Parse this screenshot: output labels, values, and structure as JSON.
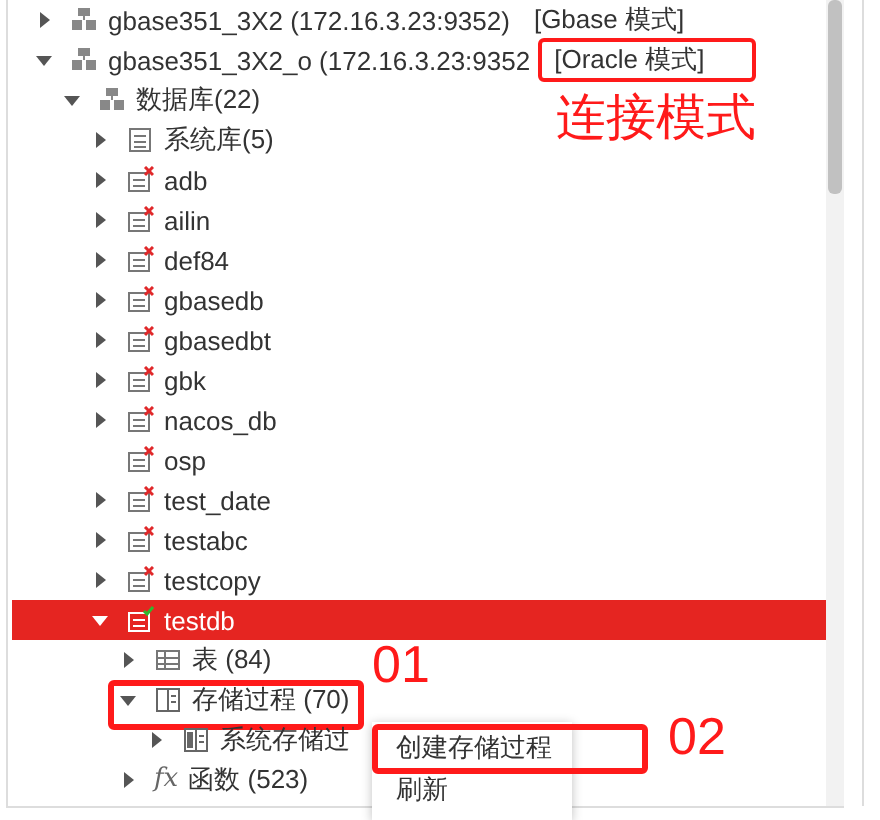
{
  "tree": [
    {
      "label": "gbase351_3X2 (172.16.3.23:9352)",
      "mode": "[Gbase 模式]",
      "mode_highlighted": false,
      "kind": "server",
      "expanded": false,
      "selected": false
    },
    {
      "label": "gbase351_3X2_o (172.16.3.23:9352",
      "mode": "[Oracle 模式]",
      "mode_highlighted": true,
      "kind": "server",
      "expanded": true,
      "selected": false,
      "children": [
        {
          "label": "数据库(22)",
          "kind": "server",
          "expanded": true,
          "selected": false,
          "children": [
            {
              "label": "系统库(5)",
              "kind": "sys_db",
              "expanded": false,
              "selected": false
            },
            {
              "label": "adb",
              "kind": "db_closed",
              "expanded": false,
              "selected": false
            },
            {
              "label": "ailin",
              "kind": "db_closed",
              "expanded": false,
              "selected": false
            },
            {
              "label": "def84",
              "kind": "db_closed",
              "expanded": false,
              "selected": false
            },
            {
              "label": "gbasedb",
              "kind": "db_closed",
              "expanded": false,
              "selected": false
            },
            {
              "label": "gbasedbt",
              "kind": "db_closed",
              "expanded": false,
              "selected": false
            },
            {
              "label": "gbk",
              "kind": "db_closed",
              "expanded": false,
              "selected": false
            },
            {
              "label": "nacos_db",
              "kind": "db_closed",
              "expanded": false,
              "selected": false
            },
            {
              "label": "osp",
              "kind": "db_closed",
              "leaf": true,
              "selected": false
            },
            {
              "label": "test_date",
              "kind": "db_closed",
              "expanded": false,
              "selected": false
            },
            {
              "label": "testabc",
              "kind": "db_closed",
              "expanded": false,
              "selected": false
            },
            {
              "label": "testcopy",
              "kind": "db_closed",
              "expanded": false,
              "selected": false
            },
            {
              "label": "testdb",
              "kind": "db_open",
              "expanded": true,
              "selected": true,
              "children": [
                {
                  "label": "表 (84)",
                  "kind": "table",
                  "expanded": false,
                  "selected": false
                },
                {
                  "label": "存储过程 (70)",
                  "kind": "proc",
                  "expanded": true,
                  "selected": false,
                  "highlighted": true,
                  "children": [
                    {
                      "label": "系统存储过",
                      "kind": "proc_sys",
                      "expanded": false,
                      "selected": false
                    }
                  ]
                },
                {
                  "label": "函数 (523)",
                  "kind": "function",
                  "glyph": "fx",
                  "expanded": false,
                  "selected": false
                }
              ]
            }
          ]
        }
      ]
    }
  ],
  "context_menu": [
    {
      "label": "创建存储过程",
      "highlighted": true
    },
    {
      "label": "刷新",
      "highlighted": false
    }
  ],
  "annotations": [
    "连接模式",
    "01",
    "02"
  ]
}
